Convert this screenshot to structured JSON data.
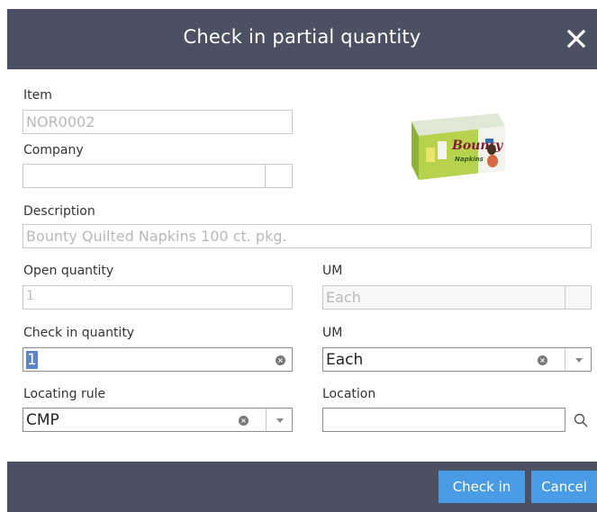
{
  "dialog": {
    "title": "Check in partial quantity",
    "close_icon": "close-icon"
  },
  "fields": {
    "item": {
      "label": "Item",
      "value": "NOR0002"
    },
    "company": {
      "label": "Company",
      "value": ""
    },
    "description": {
      "label": "Description",
      "value": "Bounty Quilted Napkins 100 ct. pkg."
    },
    "open_quantity": {
      "label": "Open quantity",
      "value": "1"
    },
    "open_um": {
      "label": "UM",
      "value": "Each"
    },
    "checkin_quantity": {
      "label": "Check in quantity",
      "value": "1"
    },
    "checkin_um": {
      "label": "UM",
      "value": "Each"
    },
    "locating_rule": {
      "label": "Locating rule",
      "value": "CMP"
    },
    "location": {
      "label": "Location",
      "value": ""
    }
  },
  "product_image": {
    "brand": "Bounty",
    "product": "Napkins"
  },
  "buttons": {
    "check_in": "Check in",
    "cancel": "Cancel"
  },
  "colors": {
    "header": "#4b5162",
    "primary_button": "#4a9be5"
  }
}
